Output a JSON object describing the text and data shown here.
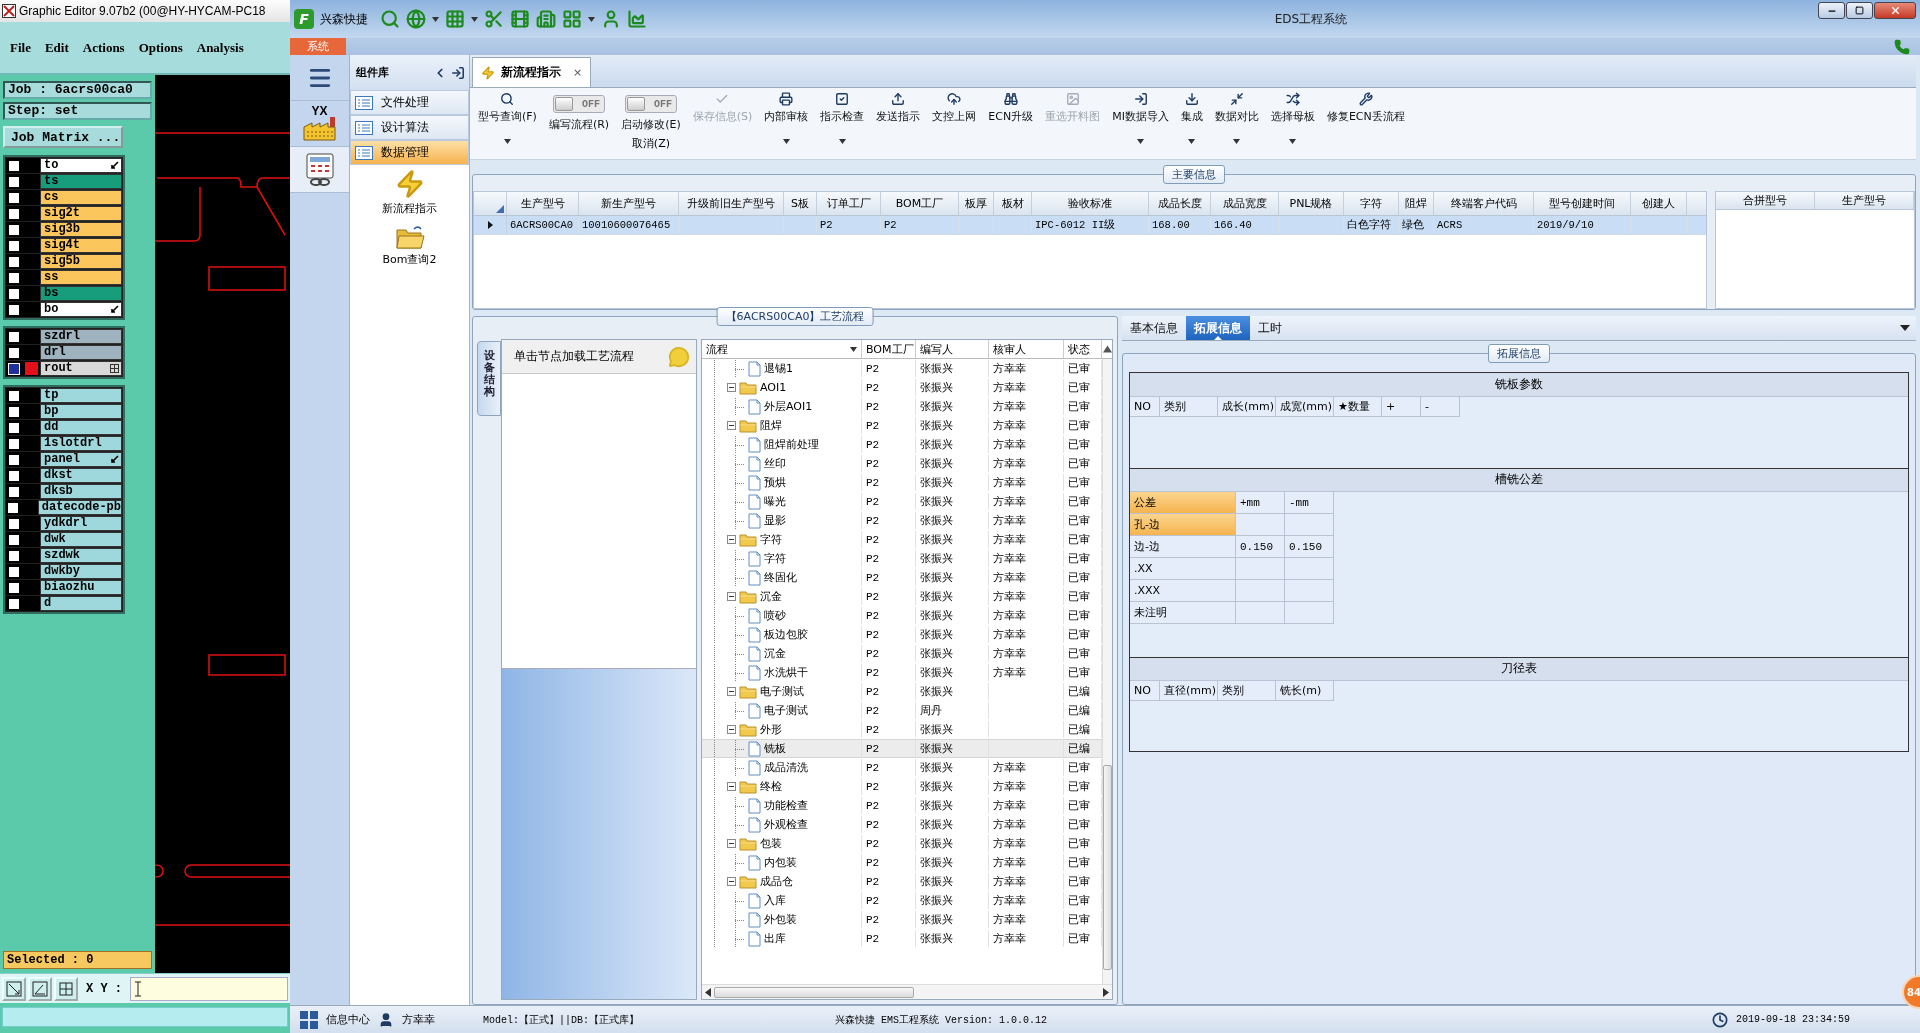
{
  "editor": {
    "title": "Graphic Editor 9.07b2 (00@HY-HYCAM-PC18",
    "menu": [
      "File",
      "Edit",
      "Actions",
      "Options",
      "Analysis"
    ],
    "job": "Job : 6acrs00ca0",
    "step": "Step: set",
    "matrix_button": "Job Matrix ...",
    "layer_groups": [
      {
        "layers": [
          {
            "name": "to",
            "color": "#ffffff",
            "active": false,
            "kind": "pointer"
          },
          {
            "name": "ts",
            "color": "#179c7c",
            "active": false,
            "kind": "plain"
          },
          {
            "name": "cs",
            "color": "#fbc65c",
            "active": false,
            "kind": "plain"
          },
          {
            "name": "sig2t",
            "color": "#fbc65c",
            "active": false,
            "kind": "plain"
          },
          {
            "name": "sig3b",
            "color": "#fbc65c",
            "active": false,
            "kind": "plain"
          },
          {
            "name": "sig4t",
            "color": "#fbc65c",
            "active": false,
            "kind": "plain"
          },
          {
            "name": "sig5b",
            "color": "#fbc65c",
            "active": false,
            "kind": "plain"
          },
          {
            "name": "ss",
            "color": "#fbc65c",
            "active": false,
            "kind": "plain"
          },
          {
            "name": "bs",
            "color": "#179c7c",
            "active": false,
            "kind": "plain"
          },
          {
            "name": "bo",
            "color": "#ffffff",
            "active": false,
            "kind": "pointer"
          }
        ]
      },
      {
        "layers": [
          {
            "name": "szdrl",
            "color": "#9eb3be",
            "active": false,
            "kind": "plain"
          },
          {
            "name": "drl",
            "color": "#9eb3be",
            "active": false,
            "kind": "plain"
          },
          {
            "name": "rout",
            "color": "#d9d9d9",
            "active": true,
            "kind": "grid"
          }
        ]
      },
      {
        "layers": [
          {
            "name": "tp",
            "color": "#9fd8dc",
            "active": false,
            "kind": "plain"
          },
          {
            "name": "bp",
            "color": "#9fd8dc",
            "active": false,
            "kind": "plain"
          },
          {
            "name": "dd",
            "color": "#9fd8dc",
            "active": false,
            "kind": "plain"
          },
          {
            "name": "1slotdrl",
            "color": "#9fd8dc",
            "active": false,
            "kind": "plain"
          },
          {
            "name": "panel",
            "color": "#9fd8dc",
            "active": false,
            "kind": "pointer"
          },
          {
            "name": "dkst",
            "color": "#9fd8dc",
            "active": false,
            "kind": "plain"
          },
          {
            "name": "dksb",
            "color": "#9fd8dc",
            "active": false,
            "kind": "plain"
          },
          {
            "name": "datecode-pb",
            "color": "#9fd8dc",
            "active": false,
            "kind": "plain"
          },
          {
            "name": "ydkdrl",
            "color": "#9fd8dc",
            "active": false,
            "kind": "plain"
          },
          {
            "name": "dwk",
            "color": "#9fd8dc",
            "active": false,
            "kind": "plain"
          },
          {
            "name": "szdwk",
            "color": "#9fd8dc",
            "active": false,
            "kind": "plain"
          },
          {
            "name": "dwkby",
            "color": "#9fd8dc",
            "active": false,
            "kind": "plain"
          },
          {
            "name": "biaozhu",
            "color": "#9fd8dc",
            "active": false,
            "kind": "plain"
          },
          {
            "name": "d",
            "color": "#9fd8dc",
            "active": false,
            "kind": "plain"
          }
        ]
      }
    ],
    "selected_count": "Selected : 0",
    "xy_label": "X Y :"
  },
  "app": {
    "logo": "F",
    "brand": "兴森快捷",
    "title": "EDS工程系统",
    "system_tab": "系统"
  },
  "sidebar": {
    "logo_text": "YX",
    "title": "组件库",
    "categories": [
      {
        "label": "文件处理",
        "selected": false
      },
      {
        "label": "设计算法",
        "selected": false
      },
      {
        "label": "数据管理",
        "selected": true
      }
    ],
    "items": [
      {
        "label": "新流程指示",
        "kind": "bolt"
      },
      {
        "label": "Bom查询2",
        "kind": "folder"
      }
    ]
  },
  "doc_tab": {
    "label": "新流程指示",
    "close": "×"
  },
  "toolbar": [
    {
      "kind": "button",
      "label": "型号查询(F)",
      "dropdown": true,
      "disabled": false
    },
    {
      "kind": "toggle",
      "label": "编写流程(R)",
      "switch_text": "OFF",
      "on": false,
      "disabled": false
    },
    {
      "kind": "toggle",
      "label": "启动修改(E)",
      "sublabel": "取消(Z)",
      "switch_text": "OFF",
      "on": false,
      "disabled": false
    },
    {
      "kind": "button",
      "label": "保存信息(S)",
      "dropdown": false,
      "disabled": true
    },
    {
      "kind": "button",
      "label": "内部审核",
      "dropdown": true,
      "disabled": false
    },
    {
      "kind": "button",
      "label": "指示检查",
      "dropdown": true,
      "disabled": false
    },
    {
      "kind": "button",
      "label": "发送指示",
      "dropdown": false,
      "disabled": false
    },
    {
      "kind": "button",
      "label": "文控上网",
      "dropdown": false,
      "disabled": false
    },
    {
      "kind": "button",
      "label": "ECN升级",
      "dropdown": false,
      "disabled": false
    },
    {
      "kind": "button",
      "label": "重选开料图",
      "dropdown": false,
      "disabled": true
    },
    {
      "kind": "button",
      "label": "MI数据导入",
      "dropdown": true,
      "disabled": false
    },
    {
      "kind": "button",
      "label": "集成",
      "dropdown": true,
      "disabled": false
    },
    {
      "kind": "button",
      "label": "数据对比",
      "dropdown": true,
      "disabled": false
    },
    {
      "kind": "button",
      "label": "选择母板",
      "dropdown": true,
      "disabled": false
    },
    {
      "kind": "button",
      "label": "修复ECN丢流程",
      "dropdown": false,
      "disabled": false
    }
  ],
  "main_info": {
    "title": "主要信息",
    "columns": [
      "生产型号",
      "新生产型号",
      "升级前旧生产型号",
      "S板",
      "订单工厂",
      "BOM工厂",
      "板厚",
      "板材",
      "验收标准",
      "成品长度",
      "成品宽度",
      "PNL规格",
      "字符",
      "阻焊",
      "终端客户代码",
      "型号创建时间",
      "创建人"
    ],
    "rows": [
      {
        "selected": true,
        "cells": [
          "6ACRS00CA0",
          "10010600076465",
          null,
          null,
          "P2",
          "P2",
          null,
          null,
          "IPC-6012 II级",
          "168.00",
          "166.40",
          null,
          "白色字符",
          "绿色",
          "ACRS",
          "2019/9/10",
          null
        ]
      }
    ],
    "merge_columns": [
      "合拼型号",
      "生产型号"
    ]
  },
  "process": {
    "title": "【6ACRS00CA0】工艺流程",
    "side_tab": "设备结构",
    "hint": "单击节点加载工艺流程",
    "columns": [
      "流程",
      "BOM工厂",
      "编写人",
      "核审人",
      "状态"
    ],
    "tree": [
      {
        "kind": "cut",
        "children": [
          {
            "label": "退锡1",
            "kind": "file",
            "bom": "P2",
            "writer": "张振兴",
            "reviewer": "方幸幸",
            "status": "已审",
            "selected": false
          }
        ]
      },
      {
        "label": "AOI1",
        "kind": "folder",
        "bom": "P2",
        "writer": "张振兴",
        "reviewer": "方幸幸",
        "status": "已审",
        "selected": false,
        "children": [
          {
            "label": "外层AOI1",
            "kind": "file",
            "bom": "P2",
            "writer": "张振兴",
            "reviewer": "方幸幸",
            "status": "已审",
            "selected": false
          }
        ]
      },
      {
        "label": "阻焊",
        "kind": "folder",
        "bom": "P2",
        "writer": "张振兴",
        "reviewer": "方幸幸",
        "status": "已审",
        "selected": false,
        "children": [
          {
            "label": "阻焊前处理",
            "kind": "file",
            "bom": "P2",
            "writer": "张振兴",
            "reviewer": "方幸幸",
            "status": "已审",
            "selected": false
          },
          {
            "label": "丝印",
            "kind": "file",
            "bom": "P2",
            "writer": "张振兴",
            "reviewer": "方幸幸",
            "status": "已审",
            "selected": false
          },
          {
            "label": "预烘",
            "kind": "file",
            "bom": "P2",
            "writer": "张振兴",
            "reviewer": "方幸幸",
            "status": "已审",
            "selected": false
          },
          {
            "label": "曝光",
            "kind": "file",
            "bom": "P2",
            "writer": "张振兴",
            "reviewer": "方幸幸",
            "status": "已审",
            "selected": false
          },
          {
            "label": "显影",
            "kind": "file",
            "bom": "P2",
            "writer": "张振兴",
            "reviewer": "方幸幸",
            "status": "已审",
            "selected": false
          }
        ]
      },
      {
        "label": "字符",
        "kind": "folder",
        "bom": "P2",
        "writer": "张振兴",
        "reviewer": "方幸幸",
        "status": "已审",
        "selected": false,
        "children": [
          {
            "label": "字符",
            "kind": "file",
            "bom": "P2",
            "writer": "张振兴",
            "reviewer": "方幸幸",
            "status": "已审",
            "selected": false
          },
          {
            "label": "终固化",
            "kind": "file",
            "bom": "P2",
            "writer": "张振兴",
            "reviewer": "方幸幸",
            "status": "已审",
            "selected": false
          }
        ]
      },
      {
        "label": "沉金",
        "kind": "folder",
        "bom": "P2",
        "writer": "张振兴",
        "reviewer": "方幸幸",
        "status": "已审",
        "selected": false,
        "children": [
          {
            "label": "喷砂",
            "kind": "file",
            "bom": "P2",
            "writer": "张振兴",
            "reviewer": "方幸幸",
            "status": "已审",
            "selected": false
          },
          {
            "label": "板边包胶",
            "kind": "file",
            "bom": "P2",
            "writer": "张振兴",
            "reviewer": "方幸幸",
            "status": "已审",
            "selected": false
          },
          {
            "label": "沉金",
            "kind": "file",
            "bom": "P2",
            "writer": "张振兴",
            "reviewer": "方幸幸",
            "status": "已审",
            "selected": false
          },
          {
            "label": "水洗烘干",
            "kind": "file",
            "bom": "P2",
            "writer": "张振兴",
            "reviewer": "方幸幸",
            "status": "已审",
            "selected": false
          }
        ]
      },
      {
        "label": "电子测试",
        "kind": "folder",
        "bom": "P2",
        "writer": "张振兴",
        "status": "已编",
        "selected": false,
        "children": [
          {
            "label": "电子测试",
            "kind": "file",
            "bom": "P2",
            "writer": "周丹",
            "status": "已编",
            "selected": false
          }
        ]
      },
      {
        "label": "外形",
        "kind": "folder",
        "bom": "P2",
        "writer": "张振兴",
        "status": "已编",
        "selected": false,
        "children": [
          {
            "label": "铣板",
            "kind": "file",
            "bom": "P2",
            "writer": "张振兴",
            "status": "已编",
            "selected": true
          },
          {
            "label": "成品清洗",
            "kind": "file",
            "bom": "P2",
            "writer": "张振兴",
            "reviewer": "方幸幸",
            "status": "已审",
            "selected": false
          }
        ]
      },
      {
        "label": "终检",
        "kind": "folder",
        "bom": "P2",
        "writer": "张振兴",
        "reviewer": "方幸幸",
        "status": "已审",
        "selected": false,
        "children": [
          {
            "label": "功能检查",
            "kind": "file",
            "bom": "P2",
            "writer": "张振兴",
            "reviewer": "方幸幸",
            "status": "已审",
            "selected": false
          },
          {
            "label": "外观检查",
            "kind": "file",
            "bom": "P2",
            "writer": "张振兴",
            "reviewer": "方幸幸",
            "status": "已审",
            "selected": false
          }
        ]
      },
      {
        "label": "包装",
        "kind": "folder",
        "bom": "P2",
        "writer": "张振兴",
        "reviewer": "方幸幸",
        "status": "已审",
        "selected": false,
        "children": [
          {
            "label": "内包装",
            "kind": "file",
            "bom": "P2",
            "writer": "张振兴",
            "reviewer": "方幸幸",
            "status": "已审",
            "selected": false
          }
        ]
      },
      {
        "label": "成品仓",
        "kind": "folder",
        "bom": "P2",
        "writer": "张振兴",
        "reviewer": "方幸幸",
        "status": "已审",
        "selected": false,
        "children": [
          {
            "label": "入库",
            "kind": "file",
            "bom": "P2",
            "writer": "张振兴",
            "reviewer": "方幸幸",
            "status": "已审",
            "selected": false
          },
          {
            "label": "外包装",
            "kind": "file",
            "bom": "P2",
            "writer": "张振兴",
            "reviewer": "方幸幸",
            "status": "已审",
            "selected": false
          },
          {
            "label": "出库",
            "kind": "file",
            "bom": "P2",
            "writer": "张振兴",
            "reviewer": "方幸幸",
            "status": "已审",
            "selected": false
          }
        ]
      }
    ]
  },
  "details": {
    "tabs": [
      {
        "label": "基本信息",
        "selected": false
      },
      {
        "label": "拓展信息",
        "selected": true
      },
      {
        "label": "工时",
        "selected": false
      }
    ],
    "title": "拓展信息",
    "plate_params": {
      "title": "铣板参数",
      "columns": [
        "NO",
        "类别",
        "成长(mm)",
        "成宽(mm)",
        "★数量",
        "+",
        "-"
      ]
    },
    "tolerance": {
      "title": "槽铣公差",
      "columns": [
        "公差",
        "+mm",
        "-mm"
      ],
      "rows": [
        {
          "cells": [
            "孔-边",
            null,
            null
          ],
          "selected": true
        },
        {
          "cells": [
            "边-边",
            "0.150",
            "0.150"
          ],
          "selected": false
        },
        {
          "cells": [
            ".XX",
            null,
            null
          ],
          "selected": false
        },
        {
          "cells": [
            ".XXX",
            null,
            null
          ],
          "selected": false
        },
        {
          "cells": [
            "未注明",
            null,
            null
          ],
          "selected": false
        }
      ]
    },
    "cutter_table": {
      "title": "刀径表",
      "columns": [
        "NO",
        "直径(mm)",
        "类别",
        "铣长(m)"
      ]
    }
  },
  "status_bar": {
    "info": "信息中心",
    "user": "方幸幸",
    "db": "Model:【正式】||DB:【正式库】",
    "version": "兴森快捷 EMS工程系统 Version: 1.0.0.12",
    "time": "2019-09-18 23:34:59",
    "badge": "84"
  }
}
